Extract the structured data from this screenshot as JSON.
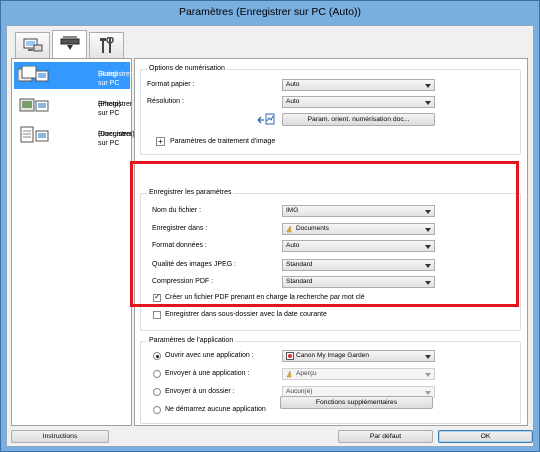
{
  "window": {
    "title": "Paramètres (Enregistrer sur PC (Auto))"
  },
  "top_tabs": [
    {
      "icon": "scan-from-computer-icon"
    },
    {
      "icon": "scan-from-panel-icon"
    },
    {
      "icon": "tools-icon"
    }
  ],
  "left_nav": {
    "items": [
      {
        "label_line1": "Enregistrer sur PC",
        "label_line2": "(Auto)",
        "selected": true,
        "icon": "auto-save-icon"
      },
      {
        "label_line1": "Enregistrer sur PC",
        "label_line2": "(Photo)",
        "selected": false,
        "icon": "photo-save-icon"
      },
      {
        "label_line1": "Enregistrer sur PC",
        "label_line2": "(Document)",
        "selected": false,
        "icon": "document-save-icon"
      }
    ]
  },
  "scan_options": {
    "title": "Options de numérisation",
    "paper_size_label": "Format papier :",
    "paper_size_value": "Auto",
    "resolution_label": "Résolution :",
    "resolution_value": "Auto",
    "orient_button": "Param. orient. numérisation doc...",
    "image_processing_label": "Paramètres de traitement d'image",
    "expand_symbol": "+"
  },
  "save_settings": {
    "title": "Enregistrer les paramètres",
    "filename_label": "Nom du fichier :",
    "filename_value": "IMG",
    "save_in_label": "Enregistrer dans :",
    "save_in_value": "Documents",
    "data_format_label": "Format données :",
    "data_format_value": "Auto",
    "jpeg_quality_label": "Qualité des images JPEG :",
    "jpeg_quality_value": "Standard",
    "pdf_compression_label": "Compression PDF :",
    "pdf_compression_value": "Standard",
    "searchable_pdf_label": "Créer un fichier PDF prenant en charge la recherche par mot clé",
    "searchable_pdf_checked": true,
    "subfolder_label": "Enregistrer dans sous-dossier avec la date courante",
    "subfolder_checked": false
  },
  "app_settings": {
    "title": "Paramètres de l'application",
    "open_with_label": "Ouvrir avec une application :",
    "open_with_value": "Canon My Image Garden",
    "send_app_label": "Envoyer à une application :",
    "send_app_value": "Aperçu",
    "send_folder_label": "Envoyer à un dossier :",
    "send_folder_value": "Aucun(e)",
    "no_app_label": "Ne démarrez aucune application",
    "selected_option": "open_with",
    "more_functions_button": "Fonctions supplémentaires"
  },
  "footer": {
    "instructions_button": "Instructions",
    "defaults_button": "Par défaut",
    "ok_button": "OK"
  },
  "colors": {
    "selection": "#3399ff",
    "highlight_frame": "#e4141e",
    "window_frame": "#79aee0"
  }
}
